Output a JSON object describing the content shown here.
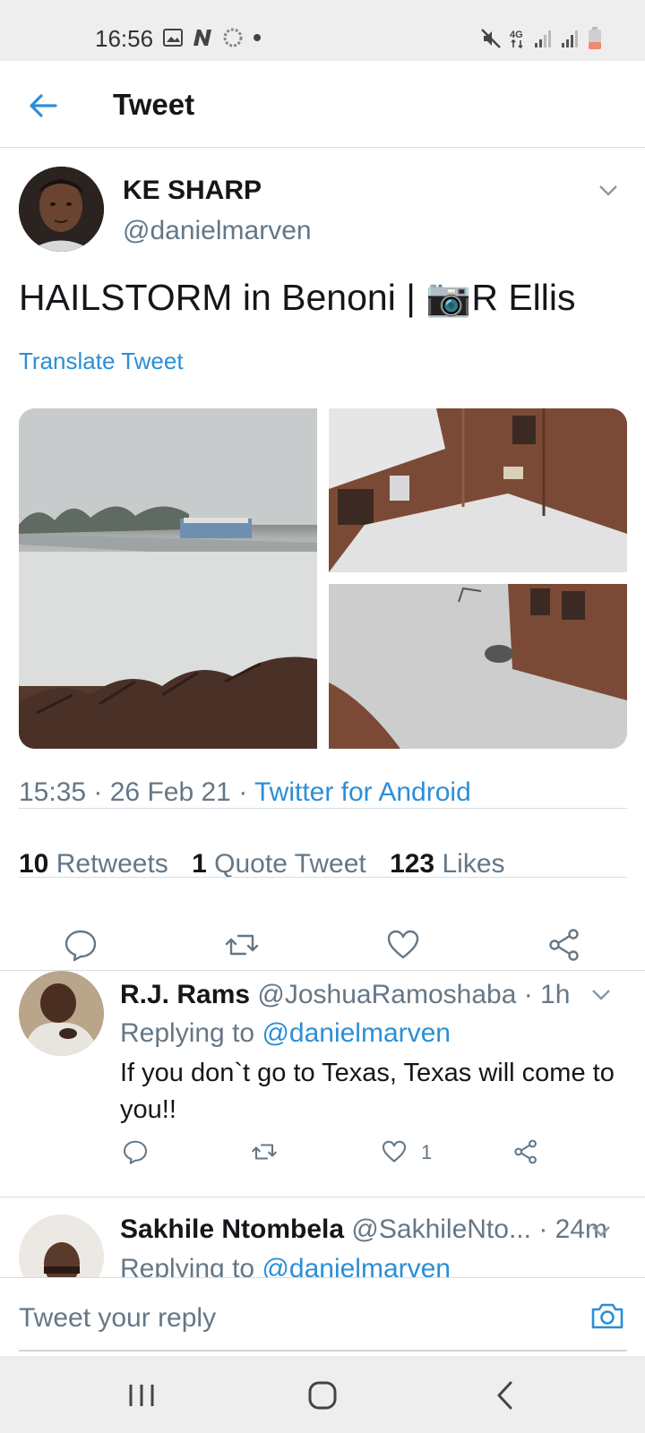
{
  "status_bar": {
    "time": "16:56",
    "left_icons": [
      "image-icon",
      "n-icon",
      "sync-icon",
      "dot-icon"
    ],
    "right_icons": [
      "mute-icon",
      "4g-icon",
      "signal-icon",
      "signal-icon-2",
      "battery-icon"
    ]
  },
  "app_bar": {
    "title": "Tweet"
  },
  "tweet": {
    "display_name": "KE SHARP",
    "handle": "@danielmarven",
    "text_before": "HAILSTORM in Benoni | ",
    "camera_emoji": "📷",
    "text_after": "R Ellis",
    "translate": "Translate Tweet",
    "time": "15:35",
    "date": "26 Feb 21",
    "source": "Twitter for Android",
    "separator": " · ",
    "stats": {
      "retweets_count": "10",
      "retweets_label": "Retweets",
      "quote_count": "1",
      "quote_label": "Quote Tweet",
      "likes_count": "123",
      "likes_label": "Likes"
    }
  },
  "replies": [
    {
      "name": "R.J. Rams",
      "handle": "@JoshuaRamoshaba",
      "time": "· 1h",
      "replying_label": "Replying to ",
      "replying_to": "@danielmarven",
      "text": "If you don`t go to Texas, Texas will come to you!!",
      "like_count": "1"
    },
    {
      "name": "Sakhile Ntombela",
      "handle": "@SakhileNto...",
      "time": "· 24m",
      "replying_label": "Replying to ",
      "replying_to": "@danielmarven"
    }
  ],
  "compose": {
    "placeholder": "Tweet your reply"
  },
  "colors": {
    "accent": "#2b8fd6",
    "text": "#14171a",
    "muted": "#657786",
    "divider": "#d9dde1"
  }
}
